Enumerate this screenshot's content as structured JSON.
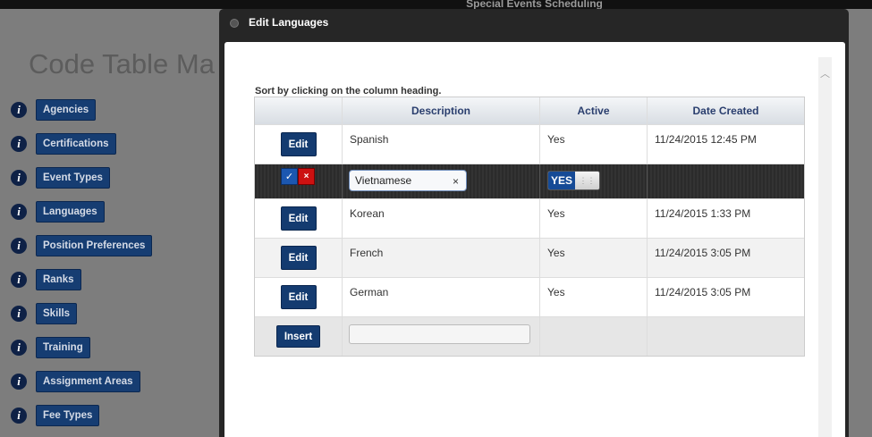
{
  "app": {
    "title": "Special Events Scheduling"
  },
  "background": {
    "page_title": "Code Table Ma",
    "nav_items": [
      {
        "label": "Agencies"
      },
      {
        "label": "Certifications"
      },
      {
        "label": "Event Types"
      },
      {
        "label": "Languages"
      },
      {
        "label": "Position Preferences"
      },
      {
        "label": "Ranks"
      },
      {
        "label": "Skills"
      },
      {
        "label": "Training"
      },
      {
        "label": "Assignment Areas"
      },
      {
        "label": "Fee Types"
      }
    ]
  },
  "modal": {
    "title": "Edit Languages",
    "sort_hint": "Sort by clicking on the column heading.",
    "columns": {
      "description": "Description",
      "active": "Active",
      "date_created": "Date Created"
    },
    "edit_label": "Edit",
    "rows": [
      {
        "description": "Spanish",
        "active": "Yes",
        "date_created": "11/24/2015 12:45 PM"
      },
      {
        "description": "Korean",
        "active": "Yes",
        "date_created": "11/24/2015 1:33 PM"
      },
      {
        "description": "French",
        "active": "Yes",
        "date_created": "11/24/2015 3:05 PM"
      },
      {
        "description": "German",
        "active": "Yes",
        "date_created": "11/24/2015 3:05 PM"
      }
    ],
    "editing_row": {
      "save_icon": "✓",
      "cancel_icon": "×",
      "description_value": "Vietnamese",
      "clear_icon": "×",
      "active_toggle_label": "YES",
      "toggle_grip_icon": "⋮⋮"
    },
    "insert_row": {
      "insert_label": "Insert",
      "description_value": ""
    }
  }
}
